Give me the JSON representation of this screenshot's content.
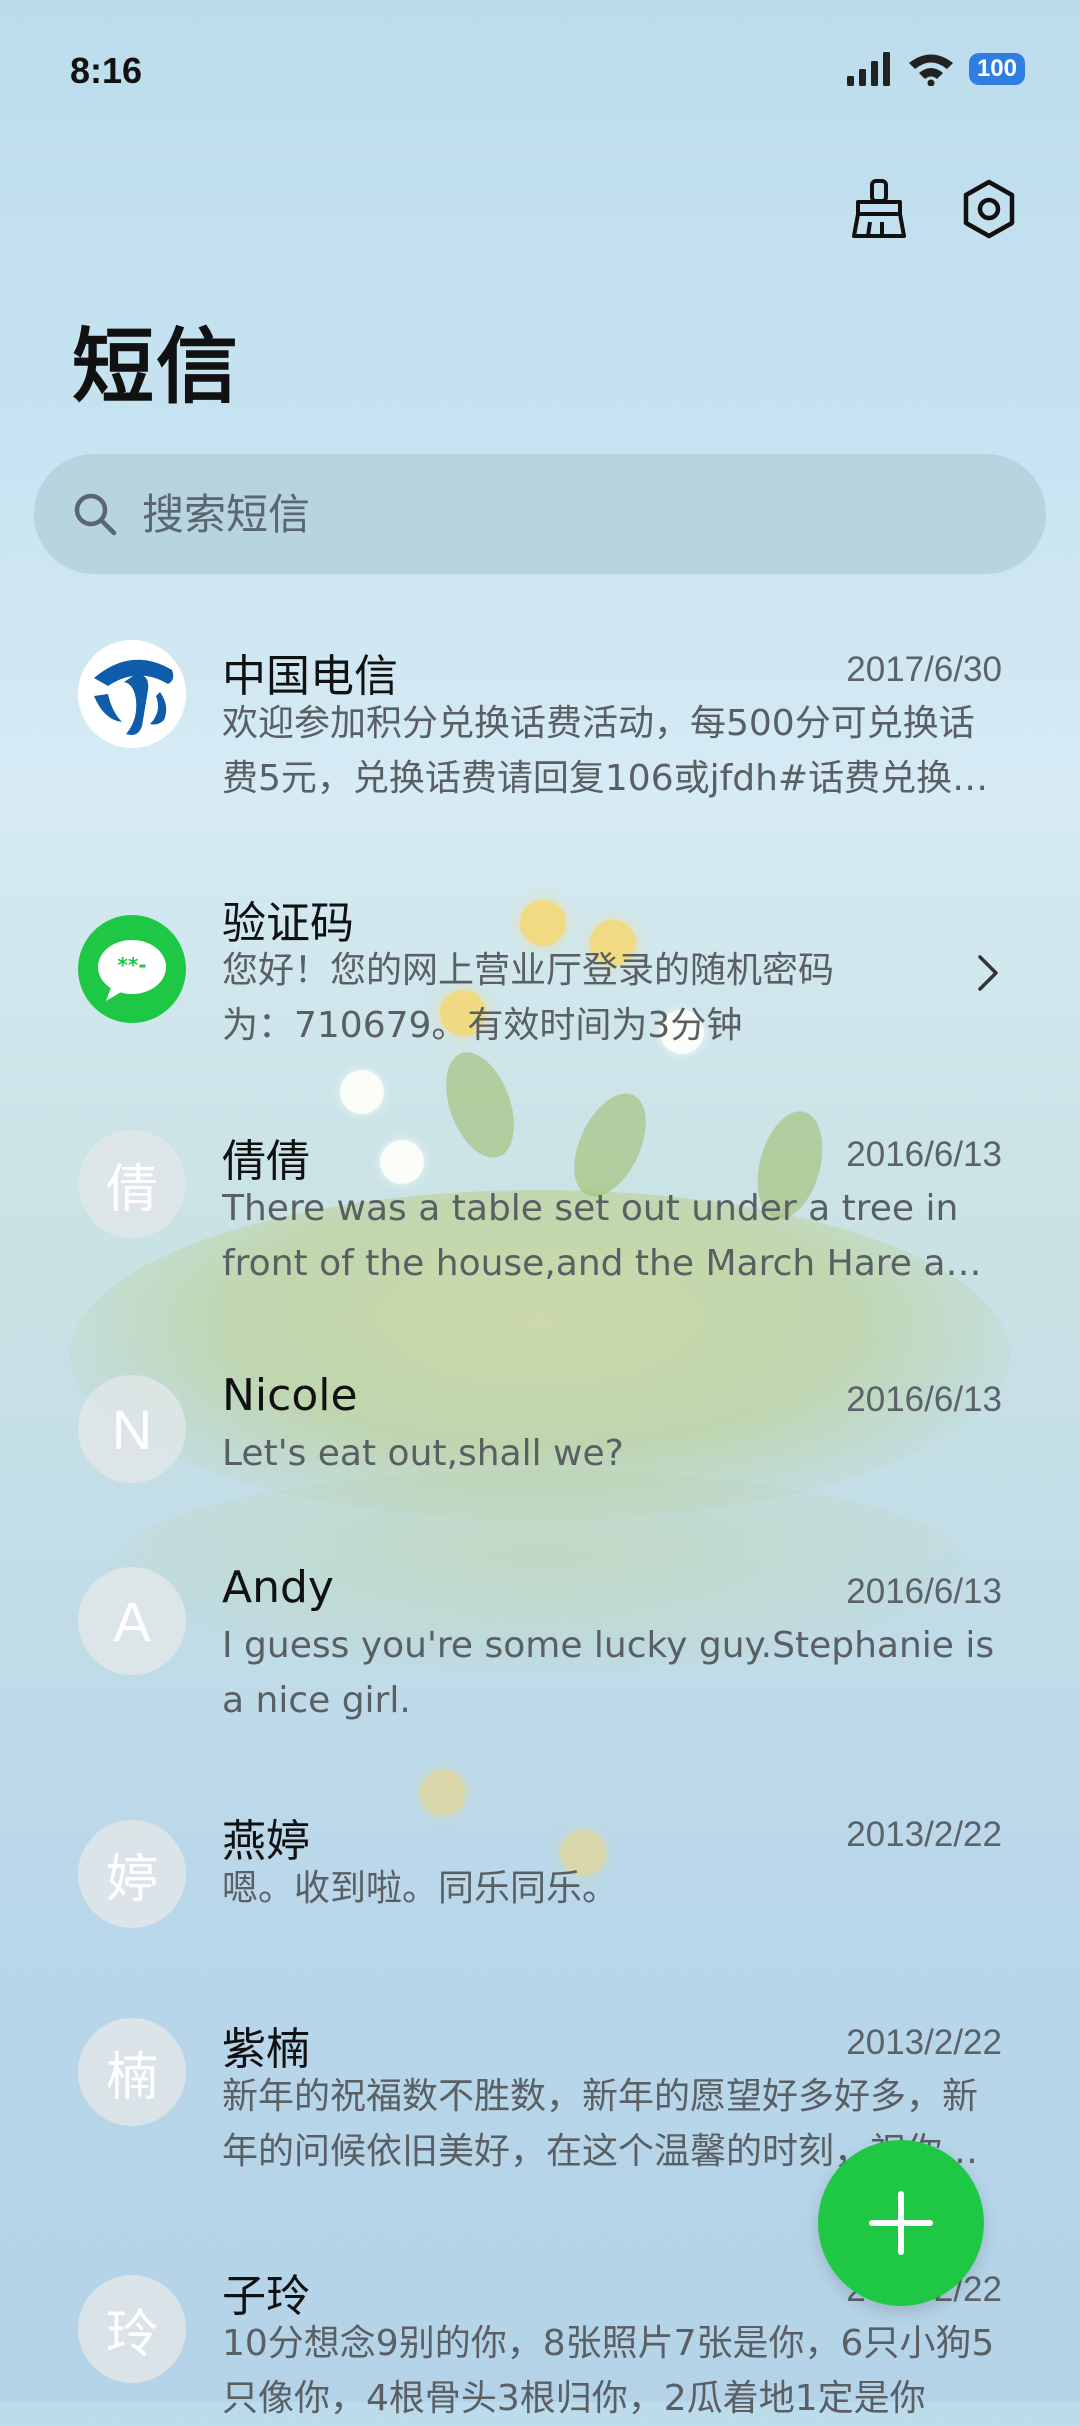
{
  "status_bar": {
    "time": "8:16",
    "battery": "100"
  },
  "header": {
    "title": "短信",
    "actions": [
      "clean-icon",
      "settings-icon"
    ]
  },
  "search": {
    "placeholder": "搜索短信",
    "value": ""
  },
  "conversations": [
    {
      "name": "中国电信",
      "date": "2017/6/30",
      "avatar": "china-telecom-logo",
      "preview": "欢迎参加积分兑换话费活动，每500分可兑换话费5元，兑换话费请回复106或jfdh#话费兑换代码"
    },
    {
      "name": "验证码",
      "date": "",
      "avatar": "verification-code-icon",
      "preview": "您好！您的网上营业厅登录的随机密码为：710679。有效时间为3分钟"
    },
    {
      "name": "倩倩",
      "date": "2016/6/13",
      "avatar_text": "倩",
      "preview": "There was a table set out under a tree in front of the house,and the March Hare and the Hatter were having tea at it"
    },
    {
      "name": "Nicole",
      "date": "2016/6/13",
      "avatar_text": "N",
      "preview": "Let's eat out,shall we?"
    },
    {
      "name": "Andy",
      "date": "2016/6/13",
      "avatar_text": "A",
      "preview": "I guess you're some lucky guy.Stephanie is a nice girl."
    },
    {
      "name": "燕婷",
      "date": "2013/2/22",
      "avatar_text": "婷",
      "preview": "嗯。收到啦。同乐同乐。"
    },
    {
      "name": "紫楠",
      "date": "2013/2/22",
      "avatar_text": "楠",
      "preview": "新年的祝福数不胜数，新年的愿望好多好多，新年的问候依旧美好，在这个温馨的时刻，祝你新年快乐"
    },
    {
      "name": "子玲",
      "date": "2013/2/22",
      "avatar_text": "玲",
      "preview": "10分想念9别的你，8张照片7张是你，6只小狗5只像你，4根骨头3根归你，2瓜着地1定是你"
    }
  ],
  "fab": {
    "icon": "plus-icon"
  },
  "colors": {
    "accent": "#1ec845",
    "battery": "#2f7fe3"
  }
}
